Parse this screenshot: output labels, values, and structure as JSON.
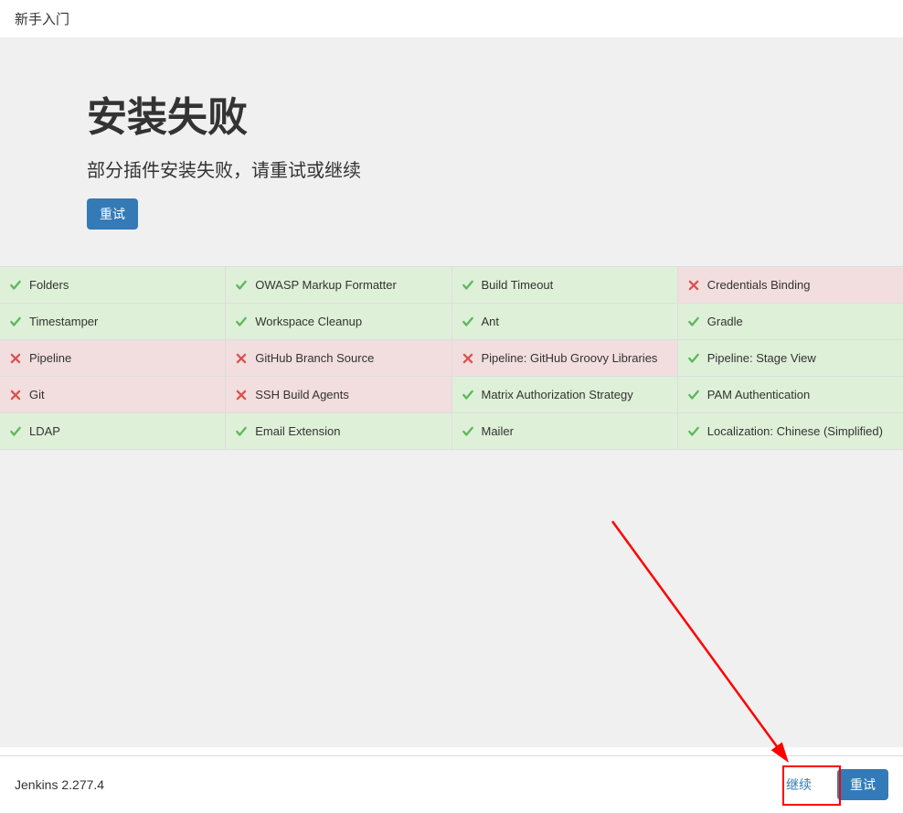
{
  "header": {
    "title": "新手入门"
  },
  "hero": {
    "heading": "安装失败",
    "subheading": "部分插件安装失败，请重试或继续",
    "retry_label": "重试"
  },
  "plugins": [
    {
      "name": "Folders",
      "status": "success"
    },
    {
      "name": "OWASP Markup Formatter",
      "status": "success"
    },
    {
      "name": "Build Timeout",
      "status": "success"
    },
    {
      "name": "Credentials Binding",
      "status": "fail"
    },
    {
      "name": "Timestamper",
      "status": "success"
    },
    {
      "name": "Workspace Cleanup",
      "status": "success"
    },
    {
      "name": "Ant",
      "status": "success"
    },
    {
      "name": "Gradle",
      "status": "success"
    },
    {
      "name": "Pipeline",
      "status": "fail"
    },
    {
      "name": "GitHub Branch Source",
      "status": "fail"
    },
    {
      "name": "Pipeline: GitHub Groovy Libraries",
      "status": "fail"
    },
    {
      "name": "Pipeline: Stage View",
      "status": "success"
    },
    {
      "name": "Git",
      "status": "fail"
    },
    {
      "name": "SSH Build Agents",
      "status": "fail"
    },
    {
      "name": "Matrix Authorization Strategy",
      "status": "success"
    },
    {
      "name": "PAM Authentication",
      "status": "success"
    },
    {
      "name": "LDAP",
      "status": "success"
    },
    {
      "name": "Email Extension",
      "status": "success"
    },
    {
      "name": "Mailer",
      "status": "success"
    },
    {
      "name": "Localization: Chinese (Simplified)",
      "status": "success"
    }
  ],
  "footer": {
    "version": "Jenkins 2.277.4",
    "continue_label": "继续",
    "retry_label": "重试"
  },
  "colors": {
    "primary": "#337ab7",
    "success_bg": "#dff0d8",
    "fail_bg": "#f2dede",
    "success_icon": "#5cb85c",
    "fail_icon": "#d9534f"
  }
}
